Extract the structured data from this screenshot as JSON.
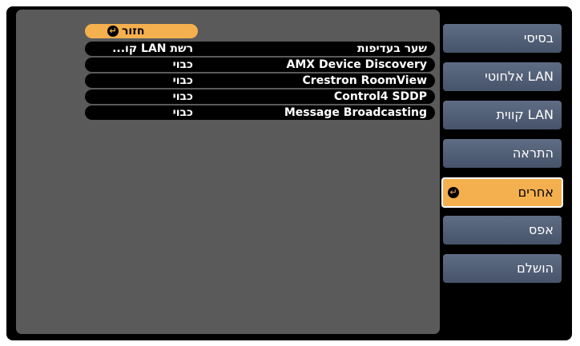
{
  "back_button": {
    "label": "חזור",
    "icon": "enter-icon"
  },
  "settings": [
    {
      "name": "שער בעדיפות",
      "value": "רשת LAN קו..."
    },
    {
      "name": "AMX Device Discovery",
      "value": "כבוי"
    },
    {
      "name": "Crestron RoomView",
      "value": "כבוי"
    },
    {
      "name": "Control4 SDDP",
      "value": "כבוי"
    },
    {
      "name": "Message Broadcasting",
      "value": "כבוי"
    }
  ],
  "tabs": [
    {
      "label": "בסיסי"
    },
    {
      "label": "LAN אלחוטי"
    },
    {
      "label": "LAN קווית"
    },
    {
      "label": "התראה"
    },
    {
      "label": "אחרים",
      "active": true
    },
    {
      "label": "אפס"
    },
    {
      "label": "הושלם"
    }
  ],
  "colors": {
    "accent": "#f4b04e",
    "tab": "#55627a",
    "panel": "#5a5a5a",
    "background": "#000000"
  }
}
